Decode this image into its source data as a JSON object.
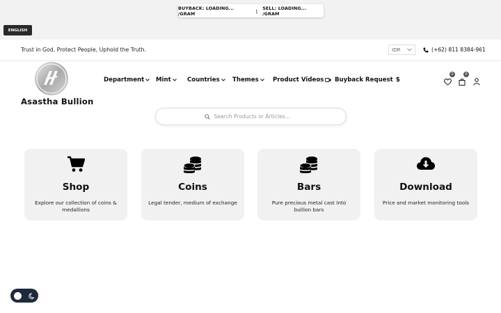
{
  "topbar": {
    "buyback": "BUYBACK: LOADING... /GRAM",
    "separator": "|",
    "sell": "SELL: LOADING... /GRAM",
    "language": "ENGLISH"
  },
  "infobar": {
    "tagline": "Trust in God, Protect People, Uphold the Truth.",
    "currency": "IDR",
    "phone": "(+62) 811 8384-961"
  },
  "header": {
    "brand": "Asastha Bullion",
    "nav": [
      {
        "label": "Department",
        "icon": "chevron-down-icon"
      },
      {
        "label": "Mint",
        "icon": "chevron-down-icon"
      },
      {
        "label": "Countries",
        "icon": "chevron-down-icon"
      },
      {
        "label": "Themes",
        "icon": "chevron-down-icon"
      },
      {
        "label": "Product Videos",
        "icon": "video-icon"
      },
      {
        "label": "Buyback Request",
        "icon": "dollar-icon"
      }
    ],
    "wishlist_count": "0",
    "cart_count": "0"
  },
  "search": {
    "placeholder": "Search Products or Articles..."
  },
  "cards": [
    {
      "title": "Shop",
      "desc": "Explore our collection of coins & medallions",
      "icon": "cart-icon"
    },
    {
      "title": "Coins",
      "desc": "Legal tender, medium of exchange",
      "icon": "coins-icon"
    },
    {
      "title": "Bars",
      "desc": "Pure precious metal cast Into bullion bars",
      "icon": "coins-icon"
    },
    {
      "title": "Download",
      "desc": "Price and market monitoring tools",
      "icon": "cloud-download-icon"
    }
  ],
  "theme_toggle": {
    "mode": "light"
  }
}
